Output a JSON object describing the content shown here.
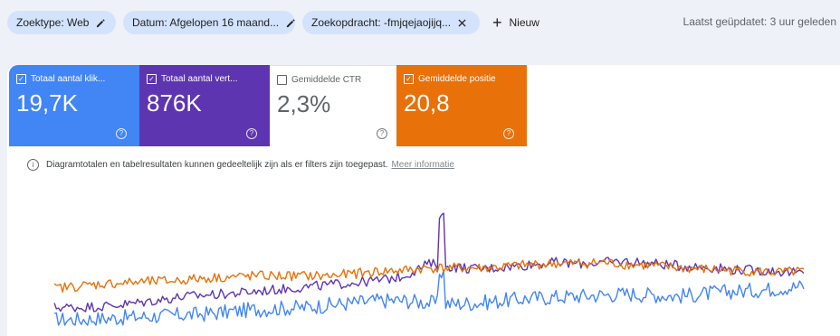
{
  "filters": {
    "search_type": "Zoektype: Web",
    "date": "Datum: Afgelopen 16 maand...",
    "query": "Zoekopdracht: -fmjqejaojijq...",
    "new_label": "Nieuw"
  },
  "updated": "Laatst geüpdatet: 3 uur geleden",
  "metrics": {
    "clicks": {
      "label": "Totaal aantal klik...",
      "value": "19,7K",
      "checked": true,
      "color": "#4285f4"
    },
    "impressions": {
      "label": "Totaal aantal vert...",
      "value": "876K",
      "checked": true,
      "color": "#5e35b1"
    },
    "ctr": {
      "label": "Gemiddelde CTR",
      "value": "2,3%",
      "checked": false
    },
    "position": {
      "label": "Gemiddelde positie",
      "value": "20,8",
      "checked": true,
      "color": "#e8710a"
    }
  },
  "info": {
    "text": "Diagramtotalen en tabelresultaten kunnen gedeeltelijk zijn als er filters zijn toegepast.",
    "link": "Meer informatie"
  },
  "chart_data": {
    "type": "line",
    "series": [
      {
        "name": "Totaal aantal klik...",
        "color": "#4285f4",
        "trend": [
          0.05,
          0.05,
          0.06,
          0.07,
          0.08,
          0.09,
          0.1,
          0.12,
          0.14,
          0.15,
          0.16,
          0.18,
          0.2,
          0.22,
          0.22,
          0.2,
          0.19,
          0.2,
          0.22,
          0.24,
          0.25,
          0.26,
          0.27,
          0.28,
          0.27,
          0.26,
          0.28,
          0.3,
          0.31,
          0.33,
          0.35
        ]
      },
      {
        "name": "Totaal aantal vert...",
        "color": "#5e35b1",
        "trend": [
          0.16,
          0.16,
          0.17,
          0.19,
          0.22,
          0.25,
          0.27,
          0.28,
          0.3,
          0.32,
          0.34,
          0.36,
          0.38,
          0.4,
          0.44,
          0.55,
          0.52,
          0.5,
          0.52,
          0.54,
          0.56,
          0.55,
          0.56,
          0.57,
          0.55,
          0.53,
          0.52,
          0.5,
          0.49,
          0.48,
          0.46
        ]
      },
      {
        "name": "Gemiddelde positie",
        "color": "#e8710a",
        "trend": [
          0.33,
          0.35,
          0.37,
          0.38,
          0.39,
          0.4,
          0.42,
          0.43,
          0.44,
          0.44,
          0.44,
          0.44,
          0.46,
          0.48,
          0.49,
          0.51,
          0.51,
          0.51,
          0.52,
          0.54,
          0.55,
          0.55,
          0.56,
          0.54,
          0.53,
          0.51,
          0.5,
          0.49,
          0.48,
          0.47,
          0.48
        ]
      }
    ]
  }
}
